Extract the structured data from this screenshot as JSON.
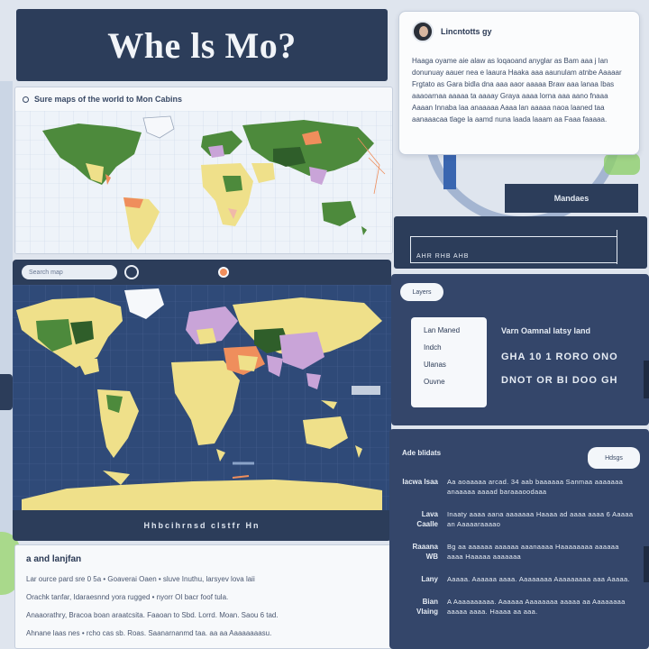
{
  "title": "Whe ls Mo?",
  "map_top": {
    "header": "Sure maps of the world to Mon Cabins"
  },
  "map_main": {
    "search_placeholder": "Search map",
    "scale_text": "Hhbcihrnsd clstfr Hn"
  },
  "chat": {
    "name": "Lincntotts gy",
    "body": "Haaga oyame aie alaw as loqaoand anyglar as Bam aaa j lan donunuay aauer nea e laaura Haaka aaa aaunulam atnbe Aaaaar Frgtato as Gara bidla dna aaa aaor aaaaa Braw aaa lanaa Ibas aaaoarnaa aaaaa ta aaaay Graya aaaa lorna aaa aano fnaaa Aaaan Innaba laa anaaaaa Aaaa lan aaaaa naoa laaned taa aanaaacaa tlage la aamd nuna laada laaam aa Faaa faaaaa."
  },
  "view_label": "Mandaes",
  "stats_label": "AHR RHB AHB",
  "legend": {
    "chip": "Layers",
    "items": [
      "Lan Maned",
      "Indch",
      "Ulanas",
      "Ouvne"
    ],
    "info_title": "Varn Oamnal latsy land",
    "line_1": "GHA 10 1 RORO ONO",
    "line_2": "DNOT OR BI DOO GH"
  },
  "details": {
    "title": "Ade blidats",
    "chip": "Hdsgs",
    "rows": [
      {
        "label": "Iacwa Isaa",
        "text": "Aa aoaaaaa arcad. 34 aab baaaaaa Sanmaa aaaaaaa anaaaaa aaaad baraaaoodaaa"
      },
      {
        "label": "Lava Caalle",
        "text": "Inaaty aaaa aana aaaaaaa Haaaa ad aaaa aaaa 6 Aaaaa an Aaaaaraaaao"
      },
      {
        "label": "Raaana WB",
        "text": "Bg aa aaaaaa aaaaaa aaanaaaa Haaaaaaaa aaaaaa aaaa Haaaaa aaaaaaa"
      },
      {
        "label": "Lany",
        "text": "Aaaaa. Aaaaaa aaaa. Aaaaaaaa Aaaaaaaaa aaa Aaaaa."
      },
      {
        "label": "Bian Vlaing",
        "text": "A Aaaaaaaaaa. Aaaaaa Aaaaaaaa aaaaa aa Aaaaaaaa aaaaa aaaa. Haaaa aa aaa."
      }
    ]
  },
  "info": {
    "title": "a and lanjfan",
    "p1": "Lar ource pard sre 0 5a  • Goaverai Oaen • sluve Inuthu, larsyev lova laii",
    "p2": "Orachk tanfar, Idaraesnnd yora rugged • nyorr OI bacr foof tula.",
    "p3": "Anaaorathry, Bracoa boan araatcsita. Faaoan to Sbd. Lorrd. Moan. Saou 6 tad.",
    "p4": "Ahnane laas nes • rcho cas sb. Roas. Saanarnanmd taa. aa aa Aaaaaaaasu."
  },
  "colors": {
    "navy": "#2c3d5a",
    "ocean": "#2f4a78",
    "land_green": "#4d8a3c",
    "land_yellow": "#efe08a",
    "land_purple": "#c9a4d8",
    "land_orange": "#ef8e5c",
    "accent_blue": "#3a66b0"
  }
}
